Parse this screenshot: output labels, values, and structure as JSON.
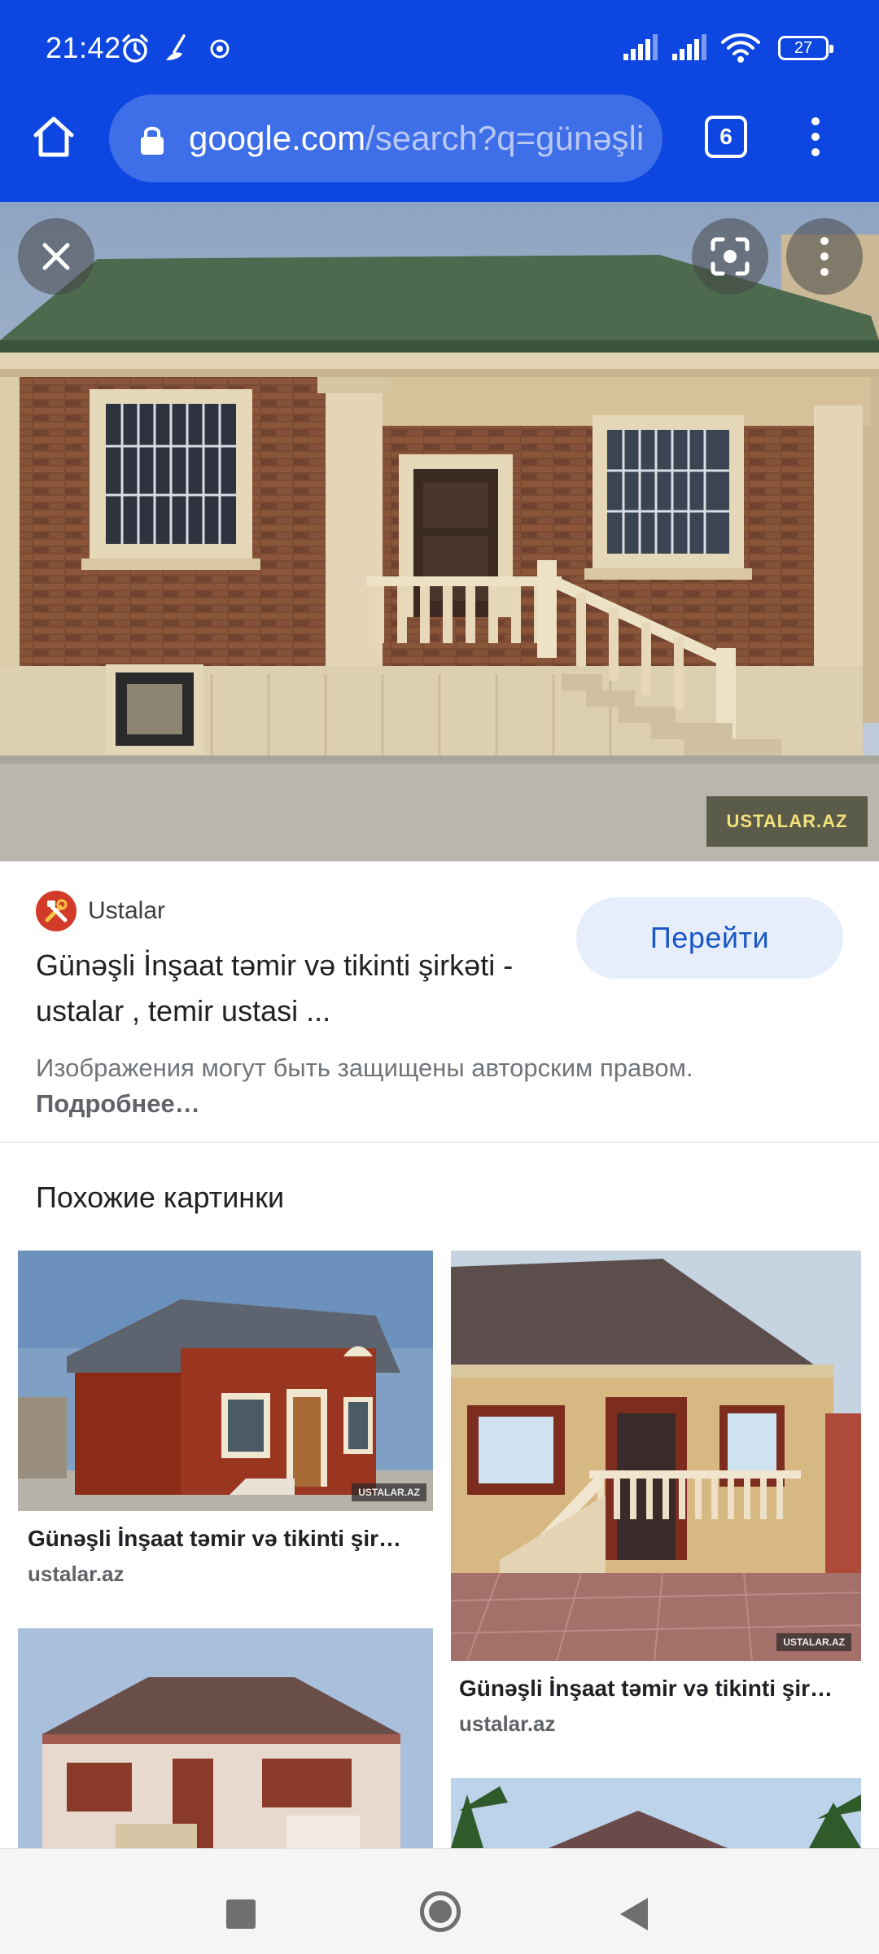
{
  "status_bar": {
    "time": "21:42",
    "battery": "27",
    "icons": [
      "alarm-icon",
      "shortcut-icon",
      "vpn-icon",
      "signal-icon",
      "signal-icon",
      "wifi-icon",
      "battery-icon"
    ]
  },
  "toolbar": {
    "url_host": "google.com",
    "url_path": "/search?q=günəşli",
    "tab_count": "6"
  },
  "hero": {
    "watermark": "USTALAR.AZ"
  },
  "result": {
    "source_name": "Ustalar",
    "title": "Günəşli İnşaat təmir və tikinti şirkəti - ustalar , temir ustasi ...",
    "visit_label": "Перейти",
    "copyright_text": "Изображения могут быть защищены авторским правом.",
    "copyright_link": "Подробнее…"
  },
  "similar": {
    "heading": "Похожие картинки",
    "items": [
      {
        "title": "Günəşli İnşaat təmir və tikinti şir…",
        "domain": "ustalar.az",
        "watermark": "USTALAR.AZ"
      },
      {
        "title": "Günəşli İnşaat təmir və tikinti şir…",
        "domain": "ustalar.az",
        "watermark": "USTALAR.AZ"
      }
    ]
  },
  "colors": {
    "chrome": "#0d46e0",
    "url_bar": "#3f6fe8",
    "visit_button_bg": "#e6eefc",
    "visit_button_text": "#1a56c7"
  }
}
